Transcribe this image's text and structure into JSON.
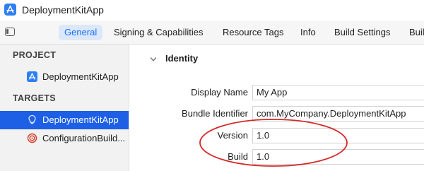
{
  "window": {
    "title": "DeploymentKitApp",
    "icon": "app-store-icon"
  },
  "tabs": [
    {
      "label": "General",
      "active": true
    },
    {
      "label": "Signing & Capabilities",
      "active": false
    },
    {
      "label": "Resource Tags",
      "active": false
    },
    {
      "label": "Info",
      "active": false
    },
    {
      "label": "Build Settings",
      "active": false
    },
    {
      "label": "Buil",
      "active": false
    }
  ],
  "sidebar": {
    "project_header": "PROJECT",
    "project_item": {
      "label": "DeploymentKitApp",
      "icon": "app-store-icon"
    },
    "targets_header": "TARGETS",
    "targets": [
      {
        "label": "DeploymentKitApp",
        "icon": "lightbulb-icon",
        "selected": true
      },
      {
        "label": "ConfigurationBuild...",
        "icon": "target-icon",
        "selected": false
      }
    ]
  },
  "identity": {
    "title": "Identity",
    "fields": [
      {
        "label": "Display Name",
        "value": "My App"
      },
      {
        "label": "Bundle Identifier",
        "value": "com.MyCompany.DeploymentKitApp"
      },
      {
        "label": "Version",
        "value": "1.0"
      },
      {
        "label": "Build",
        "value": "1.0"
      }
    ]
  },
  "colors": {
    "accent": "#1a6ef5",
    "selection": "#1d60e6",
    "annotation": "#d42a2a"
  }
}
